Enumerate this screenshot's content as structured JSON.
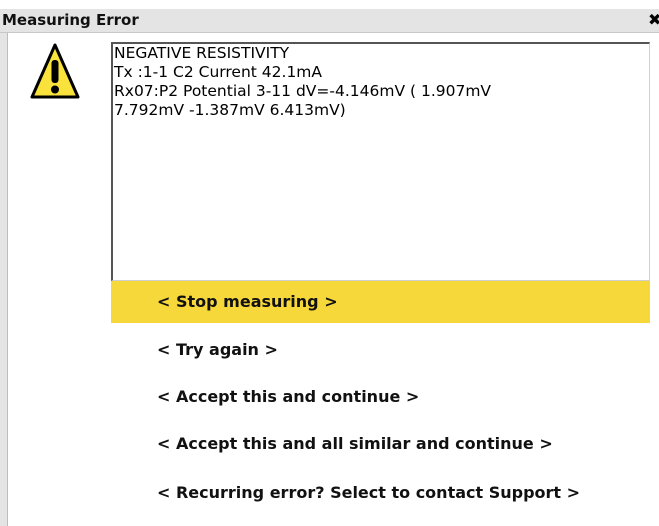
{
  "window": {
    "title": "Measuring Error",
    "close_glyph": "✖"
  },
  "icon": {
    "name": "warning-icon",
    "color": "#f9e23c"
  },
  "message": {
    "lines": [
      "NEGATIVE RESISTIVITY",
      "Tx  :1-1 C2 Current 42.1mA",
      "Rx07:P2 Potential 3-11 dV=-4.146mV ( 1.907mV",
      "7.792mV -1.387mV 6.413mV)"
    ]
  },
  "options": [
    {
      "label": "< Stop measuring >",
      "selected": true
    },
    {
      "label": "< Try again >",
      "selected": false
    },
    {
      "label": "< Accept this and continue >",
      "selected": false
    },
    {
      "label": "< Accept this and all similar and continue >",
      "selected": false
    },
    {
      "label": "< Recurring error? Select to contact Support >",
      "selected": false
    }
  ],
  "colors": {
    "highlight": "#f7d83b",
    "title_bar": "#e4e4e4"
  }
}
